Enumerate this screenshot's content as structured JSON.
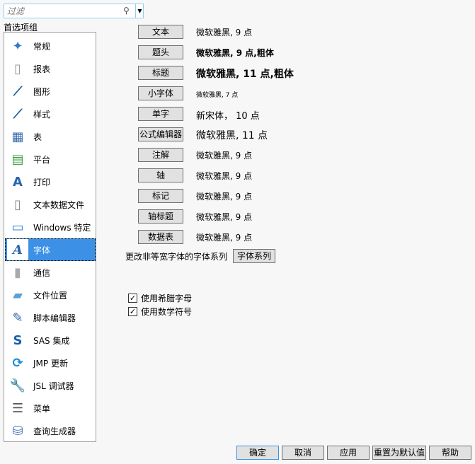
{
  "filter": {
    "placeholder": "过滤"
  },
  "group_label": "首选项组",
  "items": [
    {
      "label": "常规",
      "icon": "jmp-logo-icon"
    },
    {
      "label": "报表",
      "icon": "report-icon"
    },
    {
      "label": "图形",
      "icon": "graph-icon"
    },
    {
      "label": "样式",
      "icon": "style-icon"
    },
    {
      "label": "表",
      "icon": "table-icon"
    },
    {
      "label": "平台",
      "icon": "platform-icon"
    },
    {
      "label": "打印",
      "icon": "print-icon"
    },
    {
      "label": "文本数据文件",
      "icon": "txt-file-icon"
    },
    {
      "label": "Windows 特定",
      "icon": "monitor-icon"
    },
    {
      "label": "字体",
      "icon": "font-icon"
    },
    {
      "label": "通信",
      "icon": "usb-icon"
    },
    {
      "label": "文件位置",
      "icon": "folder-icon"
    },
    {
      "label": "脚本编辑器",
      "icon": "script-editor-icon"
    },
    {
      "label": "SAS 集成",
      "icon": "sas-icon"
    },
    {
      "label": "JMP 更新",
      "icon": "update-icon"
    },
    {
      "label": "JSL 调试器",
      "icon": "wrench-icon"
    },
    {
      "label": "菜单",
      "icon": "menu-icon"
    },
    {
      "label": "查询生成器",
      "icon": "database-icon"
    }
  ],
  "selected": "字体",
  "fonts": [
    {
      "button": "文本",
      "value": "微软雅黑, 9 点"
    },
    {
      "button": "题头",
      "value": "微软雅黑, 9 点,粗体"
    },
    {
      "button": "标题",
      "value": "微软雅黑, 11 点,粗体"
    },
    {
      "button": "小字体",
      "value": "微软雅黑, 7 点"
    },
    {
      "button": "单字",
      "value": "新宋体， 10 点"
    },
    {
      "button": "公式编辑器",
      "value": "微软雅黑, 11 点"
    },
    {
      "button": "注解",
      "value": "微软雅黑, 9 点"
    },
    {
      "button": "轴",
      "value": "微软雅黑, 9 点"
    },
    {
      "button": "标记",
      "value": "微软雅黑, 9 点"
    },
    {
      "button": "轴标题",
      "value": "微软雅黑, 9 点"
    },
    {
      "button": "数据表",
      "value": "微软雅黑, 9 点"
    }
  ],
  "family": {
    "label": "更改非等宽字体的字体系列",
    "button": "字体系列"
  },
  "checks": [
    {
      "label": "使用希腊字母",
      "checked": true
    },
    {
      "label": "使用数学符号",
      "checked": true
    }
  ],
  "footer": {
    "ok": "确定",
    "cancel": "取消",
    "apply": "应用",
    "reset": "重置为默认值",
    "help": "帮助"
  }
}
